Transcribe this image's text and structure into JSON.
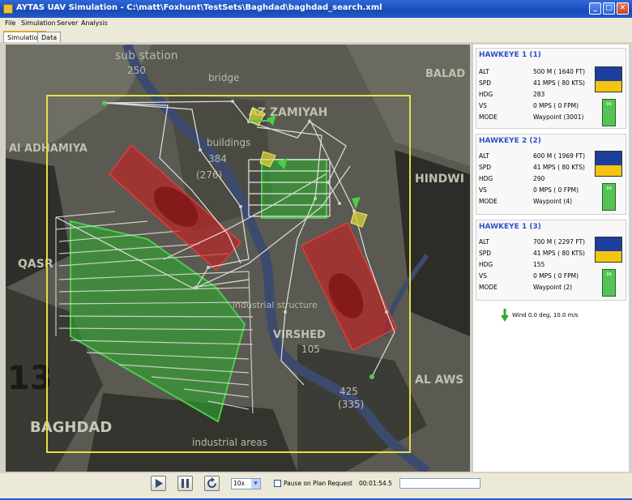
{
  "window": {
    "title": "AYTAS UAV Simulation  -  C:\\matt\\Foxhunt\\TestSets\\Baghdad\\baghdad_search.xml",
    "minimize_label": "_",
    "maximize_label": "□",
    "close_label": "✕"
  },
  "menu": {
    "items": [
      "File",
      "Simulation",
      "Server",
      "Analysis"
    ]
  },
  "tabs": [
    {
      "label": "Simulation",
      "active": true
    },
    {
      "label": "Data",
      "active": false
    }
  ],
  "map": {
    "labels": {
      "substation": "sub station",
      "num250": "250",
      "bridge": "bridge",
      "zamiyah": "AZ ZAMIYAH",
      "aladhamiya": "Al ADHAMIYA",
      "buildings": "buildings",
      "num384": "384",
      "num276": "(276)",
      "hindwi": "HINDWI",
      "qasr": "QASR",
      "industrial": "industrial structure",
      "virshed": "VIRSHED",
      "num105": "105",
      "alaws": "AL AWS",
      "num425": "425",
      "num335": "(335)",
      "baghdad": "BAGHDAD",
      "industrial_areas": "industrial areas",
      "num13": "13",
      "balad": "BALAD"
    }
  },
  "uavs": [
    {
      "name": "HAWKEYE 1 (1)",
      "alt_label": "ALT",
      "alt": "500 M  ( 1640 FT)",
      "spd_label": "SPD",
      "spd": "41 MPS ( 80 KTS)",
      "hdg_label": "HDG",
      "hdg": "283",
      "vs_label": "VS",
      "vs": "0 MPS ( 0 FPM)",
      "mode_label": "MODE",
      "mode": "Waypoint  (3001)",
      "fuel": "99"
    },
    {
      "name": "HAWKEYE 2 (2)",
      "alt_label": "ALT",
      "alt": "600 M  ( 1969 FT)",
      "spd_label": "SPD",
      "spd": "41 MPS ( 80 KTS)",
      "hdg_label": "HDG",
      "hdg": "290",
      "vs_label": "VS",
      "vs": "0 MPS ( 0 FPM)",
      "mode_label": "MODE",
      "mode": "Waypoint (4)",
      "fuel": "99"
    },
    {
      "name": "HAWKEYE 1 (3)",
      "alt_label": "ALT",
      "alt": "700 M  ( 2297 FT)",
      "spd_label": "SPD",
      "spd": "41 MPS ( 80 KTS)",
      "hdg_label": "HDG",
      "hdg": "155",
      "vs_label": "VS",
      "vs": "0 MPS ( 0 FPM)",
      "mode_label": "MODE",
      "mode": "Waypoint (2)",
      "fuel": "99"
    }
  ],
  "wind": {
    "text": "Wind 0.0 deg,  10.0 m/s"
  },
  "controls": {
    "speed_value": "10x",
    "pause_label": "Pause on Plan Request",
    "timer": "00:01:54.5"
  },
  "colors": {
    "titlebar": "#1a4bb8",
    "uav_name": "#2a55c8",
    "search_area": "#e8e040",
    "no_fly": "#c81e1e",
    "coverage": "#2ea82e"
  }
}
